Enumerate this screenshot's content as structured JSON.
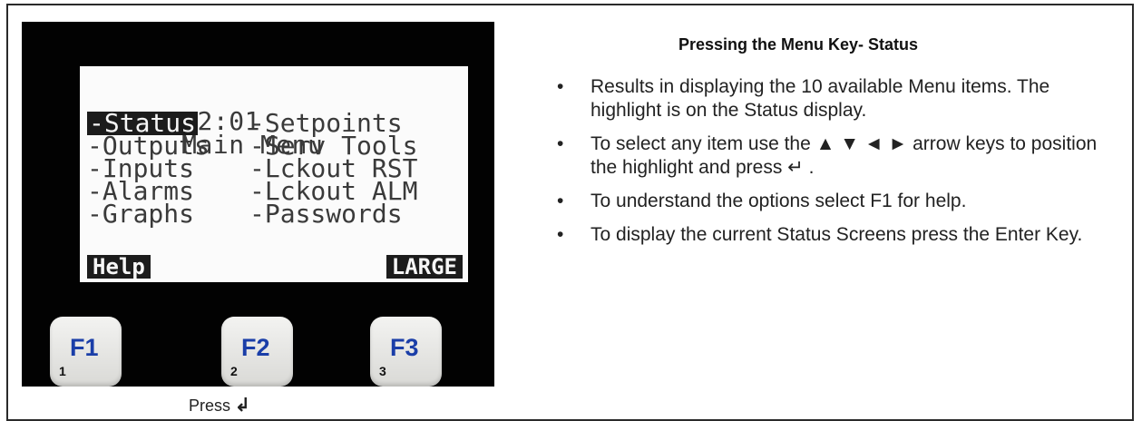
{
  "device": {
    "lcd": {
      "time": "12:01",
      "title": "Main Menu",
      "menu_left": [
        "-Status",
        "-Outputs",
        "-Inputs",
        "-Alarms",
        "-Graphs"
      ],
      "menu_right": [
        "-Setpoints",
        "-Serv Tools",
        "-Lckout RST",
        "-Lckout ALM",
        "-Passwords"
      ],
      "selected_item": "-Status",
      "soft_left": "Help",
      "soft_right": "LARGE"
    },
    "keys": [
      {
        "label": "F1",
        "num": "1"
      },
      {
        "label": "F2",
        "num": "2"
      },
      {
        "label": "F3",
        "num": "3"
      }
    ],
    "press_caption": "Press",
    "enter_icon": "enter-key-icon"
  },
  "instructions": {
    "heading": "Pressing the Menu Key- Status",
    "bullets": [
      "Results in displaying the 10 available Menu items. The highlight is on the Status display.",
      "To select any item use the ▲ ▼ ◄ ► arrow keys to position the highlight and press ↵ .",
      "To understand the options select F1 for help.",
      "To display the current Status Screens press the Enter Key."
    ]
  },
  "colors": {
    "panel": "#020202",
    "lcd_bg": "#fbfbfb",
    "key_text": "#1a3ea8"
  }
}
